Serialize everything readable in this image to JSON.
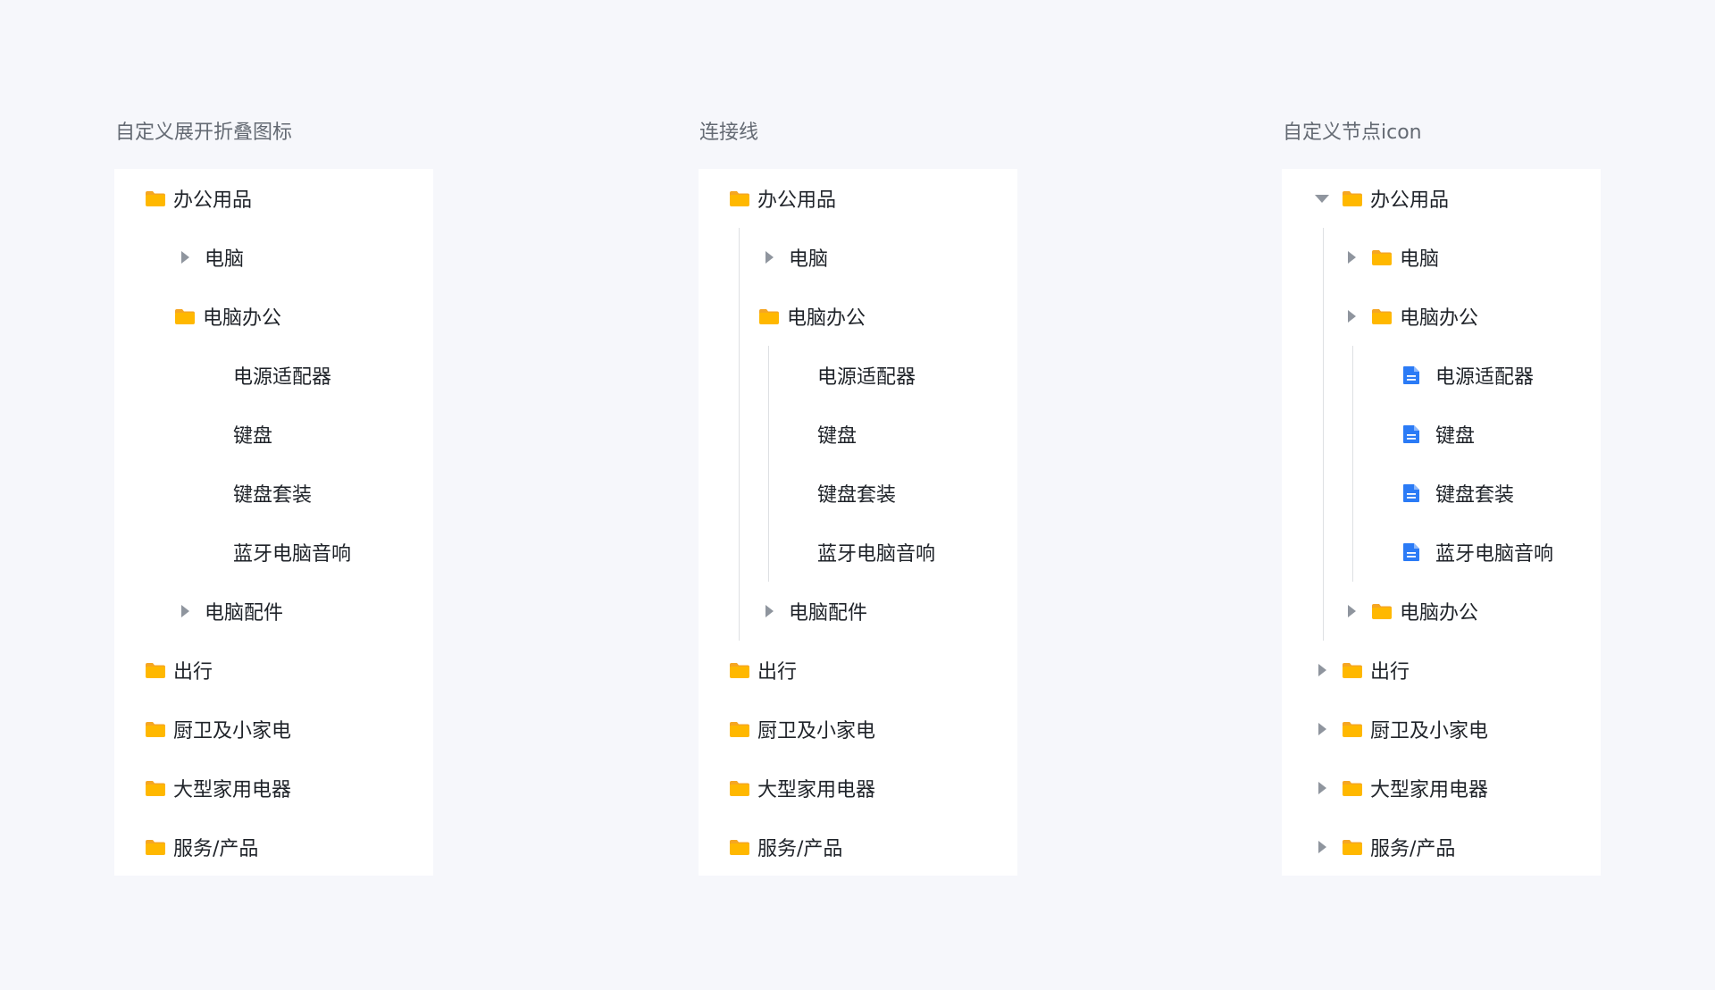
{
  "colors": {
    "folder": "#FFB200",
    "folder_tab": "#F5A623",
    "doc": "#2B7BF6",
    "arrow": "#8F959E",
    "line": "#DEE0E3"
  },
  "sections": [
    {
      "title": "自定义展开折叠图标",
      "nodes": {
        "root": "办公用品",
        "pc": "电脑",
        "pc_office": "电脑办公",
        "adapter": "电源适配器",
        "keyboard": "键盘",
        "keyboard_set": "键盘套装",
        "bt_speaker": "蓝牙电脑音响",
        "pc_parts": "电脑配件",
        "travel": "出行",
        "kitchen": "厨卫及小家电",
        "large_appliance": "大型家用电器",
        "service": "服务/产品"
      }
    },
    {
      "title": "连接线",
      "nodes": {
        "root": "办公用品",
        "pc": "电脑",
        "pc_office": "电脑办公",
        "adapter": "电源适配器",
        "keyboard": "键盘",
        "keyboard_set": "键盘套装",
        "bt_speaker": "蓝牙电脑音响",
        "pc_parts": "电脑配件",
        "travel": "出行",
        "kitchen": "厨卫及小家电",
        "large_appliance": "大型家用电器",
        "service": "服务/产品"
      }
    },
    {
      "title": "自定义节点icon",
      "nodes": {
        "root": "办公用品",
        "pc": "电脑",
        "pc_office": "电脑办公",
        "adapter": "电源适配器",
        "keyboard": "键盘",
        "keyboard_set": "键盘套装",
        "bt_speaker": "蓝牙电脑音响",
        "pc_office_2": "电脑办公",
        "travel": "出行",
        "kitchen": "厨卫及小家电",
        "large_appliance": "大型家用电器",
        "service": "服务/产品"
      }
    }
  ]
}
